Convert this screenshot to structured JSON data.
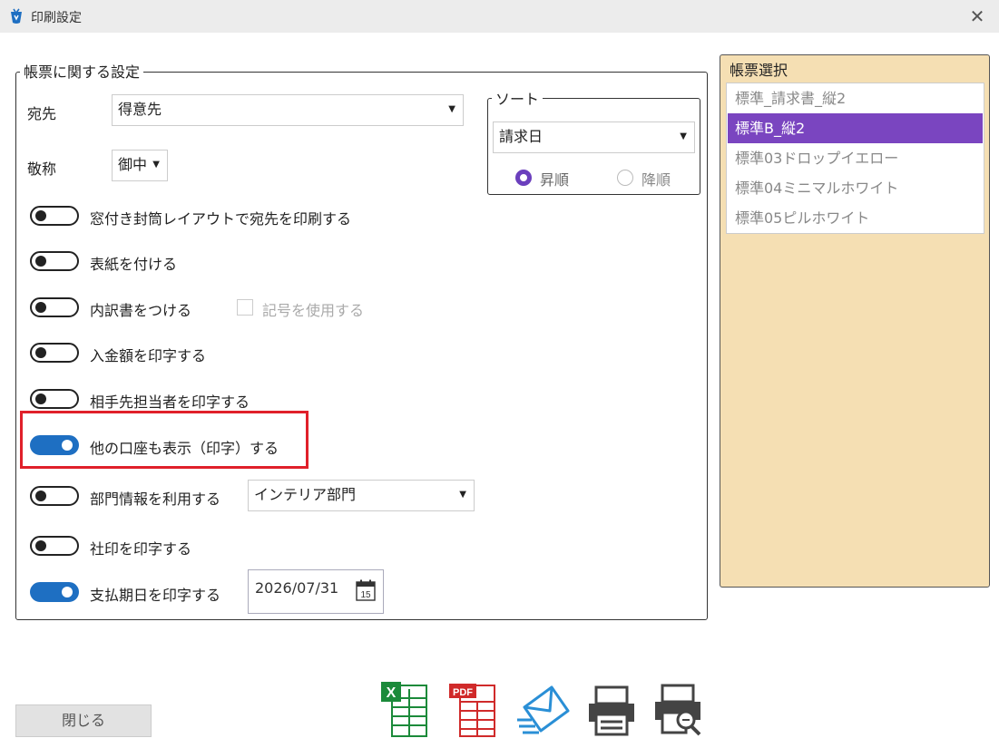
{
  "window": {
    "title": "印刷設定"
  },
  "settings": {
    "legend": "帳票に関する設定",
    "recipient_label": "宛先",
    "recipient_value": "得意先",
    "honorific_label": "敬称",
    "honorific_value": "御中",
    "toggles": [
      {
        "label": "窓付き封筒レイアウトで宛先を印刷する",
        "on": false
      },
      {
        "label": "表紙を付ける",
        "on": false
      },
      {
        "label": "内訳書をつける",
        "on": false
      },
      {
        "label": "入金額を印字する",
        "on": false
      },
      {
        "label": "相手先担当者を印字する",
        "on": false
      },
      {
        "label": "他の口座も表示（印字）する",
        "on": true
      },
      {
        "label": "部門情報を利用する",
        "on": false
      },
      {
        "label": "社印を印字する",
        "on": false
      },
      {
        "label": "支払期日を印字する",
        "on": true
      }
    ],
    "symbol_checkbox_label": "記号を使用する",
    "department_value": "インテリア部門",
    "due_date_value": "2026/07/31"
  },
  "sort": {
    "legend": "ソート",
    "value": "請求日",
    "ascending_label": "昇順",
    "descending_label": "降順",
    "selected": "ascending"
  },
  "form_select": {
    "legend": "帳票選択",
    "items": [
      {
        "label": "標準_請求書_縦2",
        "selected": false
      },
      {
        "label": "標準B_縦2",
        "selected": true
      },
      {
        "label": "標準03ドロップイエロー",
        "selected": false
      },
      {
        "label": "標準04ミニマルホワイト",
        "selected": false
      },
      {
        "label": "標準05ピルホワイト",
        "selected": false
      }
    ]
  },
  "footer": {
    "close_label": "閉じる"
  },
  "colors": {
    "accent": "#1e6fc2",
    "selection": "#7a45c0",
    "panel": "#f5dfb3",
    "highlight": "#e0202a"
  }
}
